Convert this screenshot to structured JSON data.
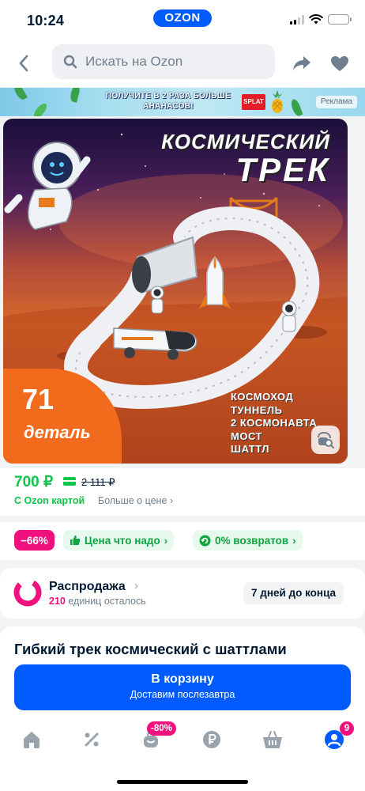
{
  "status_bar": {
    "time": "10:24",
    "brand": "OZON"
  },
  "search": {
    "placeholder": "Искать на Ozon"
  },
  "ad_banner": {
    "text": "ПОЛУЧИТЕ В 2 РАЗА БОЛЬШЕ АНАНАСОВ!",
    "brand": "SPLAT",
    "label": "Реклама"
  },
  "product_image": {
    "headline_line1": "КОСМИЧЕСКИЙ",
    "headline_line2": "ТРЕК",
    "count": "71",
    "count_unit": "деталь",
    "features": [
      "КОСМОХОД",
      "ТУННЕЛЬ",
      "2 КОСМОНАВТА",
      "МОСТ",
      "ШАТТЛ"
    ]
  },
  "price": {
    "current": "700 ₽",
    "old": "2 111 ₽",
    "ozon_card": "С Ozon картой",
    "more": "Больше о цене ›"
  },
  "chips": {
    "discount": "−66%",
    "good_price": "Цена что надо",
    "returns": "0% возвратов"
  },
  "sale": {
    "title": "Распродажа",
    "units_count": "210",
    "units_label": "единиц осталось",
    "timer": "7 дней до конца"
  },
  "product": {
    "title": "Гибкий трек космический с шаттлами"
  },
  "cart": {
    "label": "В корзину",
    "delivery": "Доставим послезавтра"
  },
  "tab_bar": {
    "promo_badge": "-80%",
    "profile_badge": "9"
  },
  "colors": {
    "accent": "#005bff",
    "green": "#10c44c",
    "pink": "#f1117e"
  }
}
